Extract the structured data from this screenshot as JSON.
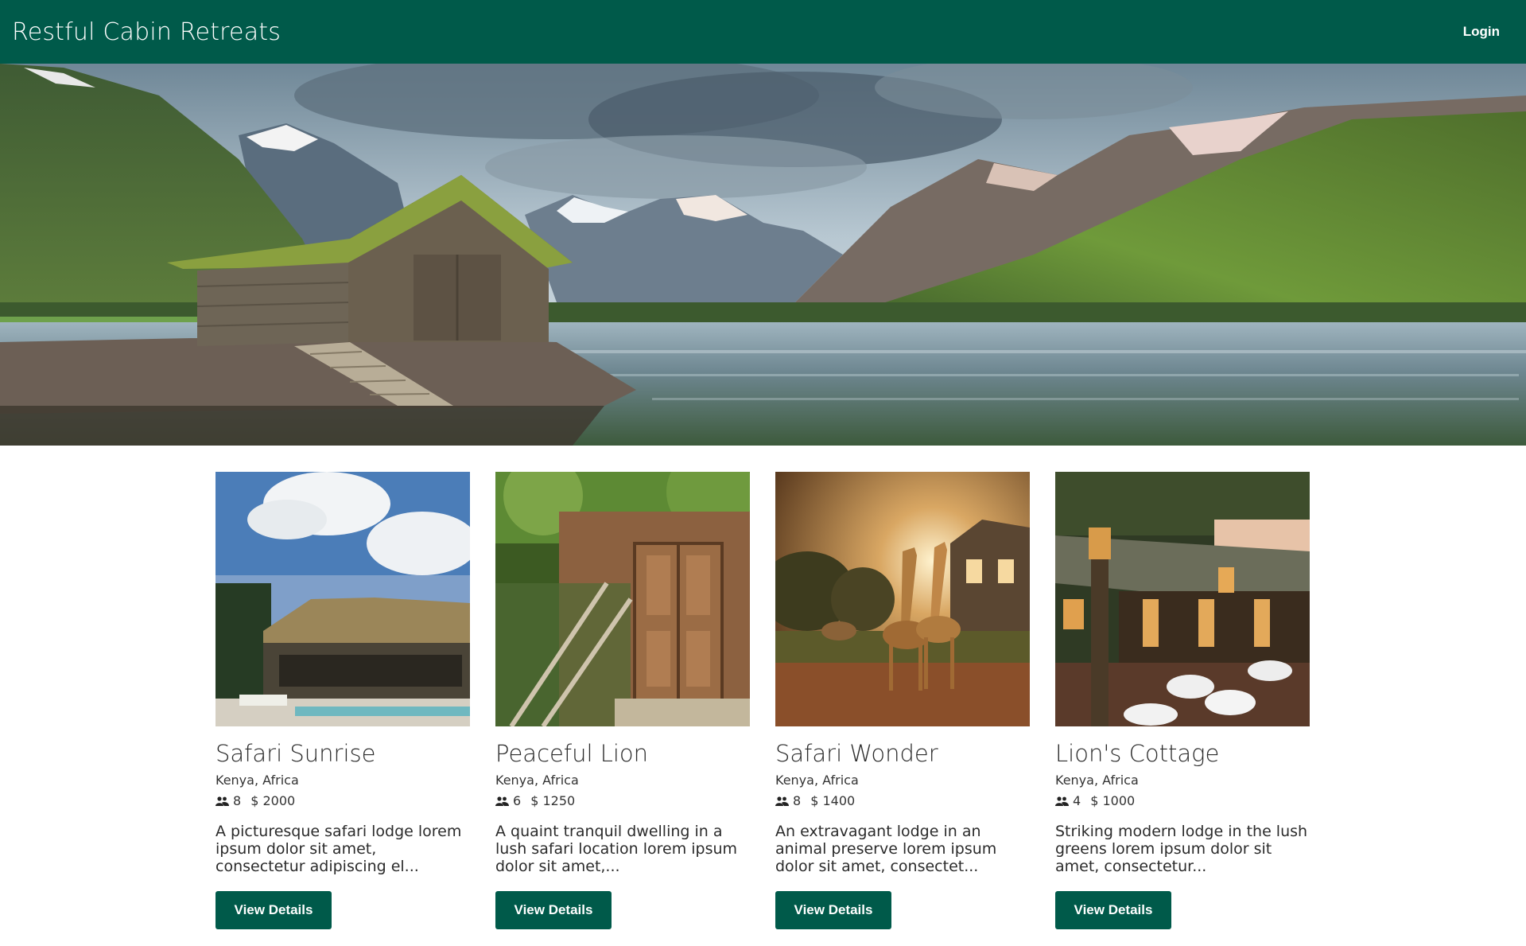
{
  "header": {
    "brand": "Restful Cabin Retreats",
    "login_label": "Login",
    "background": "#005a4a"
  },
  "hero": {
    "image_icon": "lake-cabin-mountains-photo"
  },
  "cards": [
    {
      "title": "Safari Sunrise",
      "location": "Kenya, Africa",
      "guests": "8",
      "price": "$ 2000",
      "description": "A picturesque safari lodge lorem ipsum dolor sit amet, consectetur adipiscing el...",
      "button_label": "View Details",
      "image_icon": "thatched-lodge-photo"
    },
    {
      "title": "Peaceful Lion",
      "location": "Kenya, Africa",
      "guests": "6",
      "price": "$ 1250",
      "description": "A quaint tranquil dwelling in a lush safari location lorem ipsum dolor sit amet,...",
      "button_label": "View Details",
      "image_icon": "wooden-door-cabin-photo"
    },
    {
      "title": "Safari Wonder",
      "location": "Kenya, Africa",
      "guests": "8",
      "price": "$ 1400",
      "description": "An extravagant lodge in an animal preserve lorem ipsum dolor sit amet, consectet...",
      "button_label": "View Details",
      "image_icon": "giraffes-manor-photo"
    },
    {
      "title": "Lion's Cottage",
      "location": "Kenya, Africa",
      "guests": "4",
      "price": "$ 1000",
      "description": "Striking modern lodge in the lush greens lorem ipsum dolor sit amet, consectetur...",
      "button_label": "View Details",
      "image_icon": "lantern-terrace-photo"
    }
  ]
}
